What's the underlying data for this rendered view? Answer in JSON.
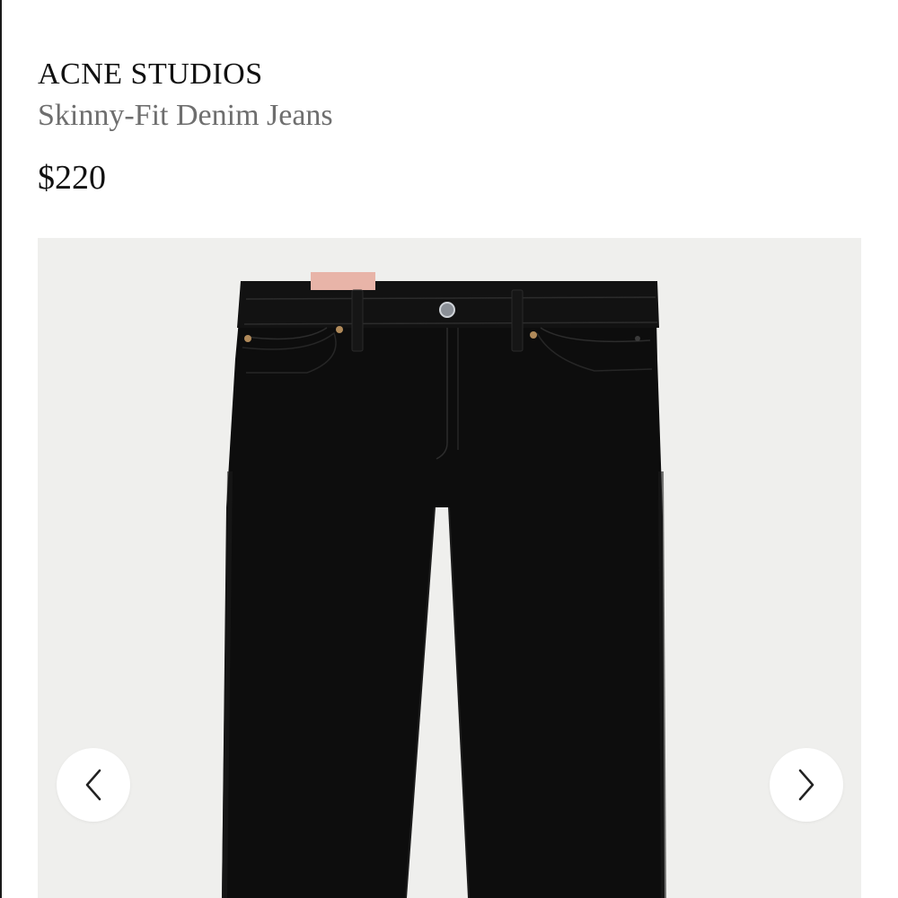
{
  "product": {
    "brand": "ACNE STUDIOS",
    "name": "Skinny-Fit Denim Jeans",
    "price": "$220"
  },
  "gallery": {
    "image_subject": "black skinny-fit denim jeans, front view",
    "background_color": "#efefed",
    "prev_icon": "chevron-left-icon",
    "next_icon": "chevron-right-icon"
  },
  "colors": {
    "brand_text": "#111111",
    "name_text": "#6e6e6e",
    "denim": "#0e0e0e",
    "tag": "#e8b4a8"
  }
}
